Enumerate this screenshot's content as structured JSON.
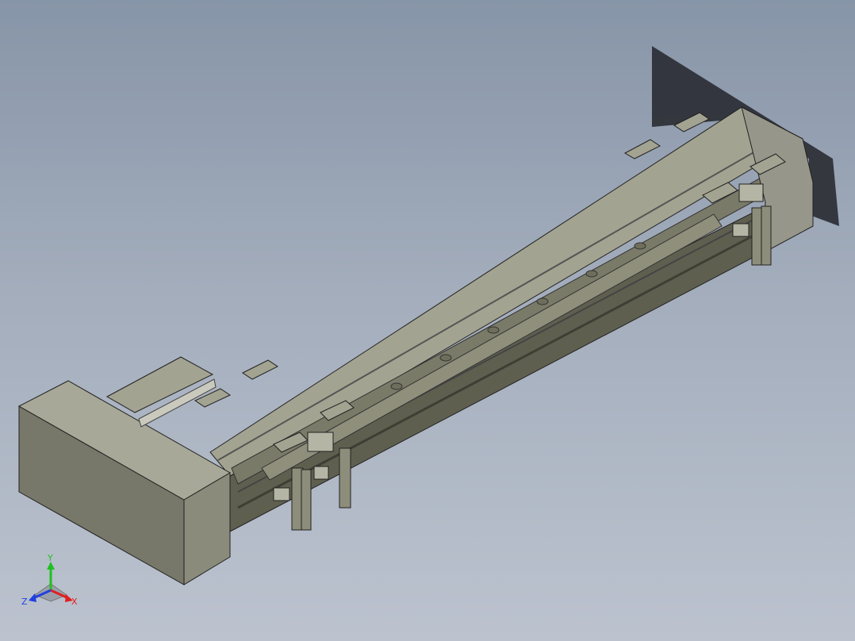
{
  "viewport": {
    "background_top": "#8795a8",
    "background_bottom": "#bcc3cf",
    "model_name": ""
  },
  "triad": {
    "x_label": "X",
    "y_label": "Y",
    "z_label": "Z",
    "x_color": "#e02020",
    "y_color": "#20c020",
    "z_color": "#2040e0"
  },
  "model": {
    "part_color_light": "#a6a694",
    "part_color_mid": "#8c8c78",
    "part_color_dark": "#5e5e4e",
    "shadow_color": "#2a2d33"
  }
}
